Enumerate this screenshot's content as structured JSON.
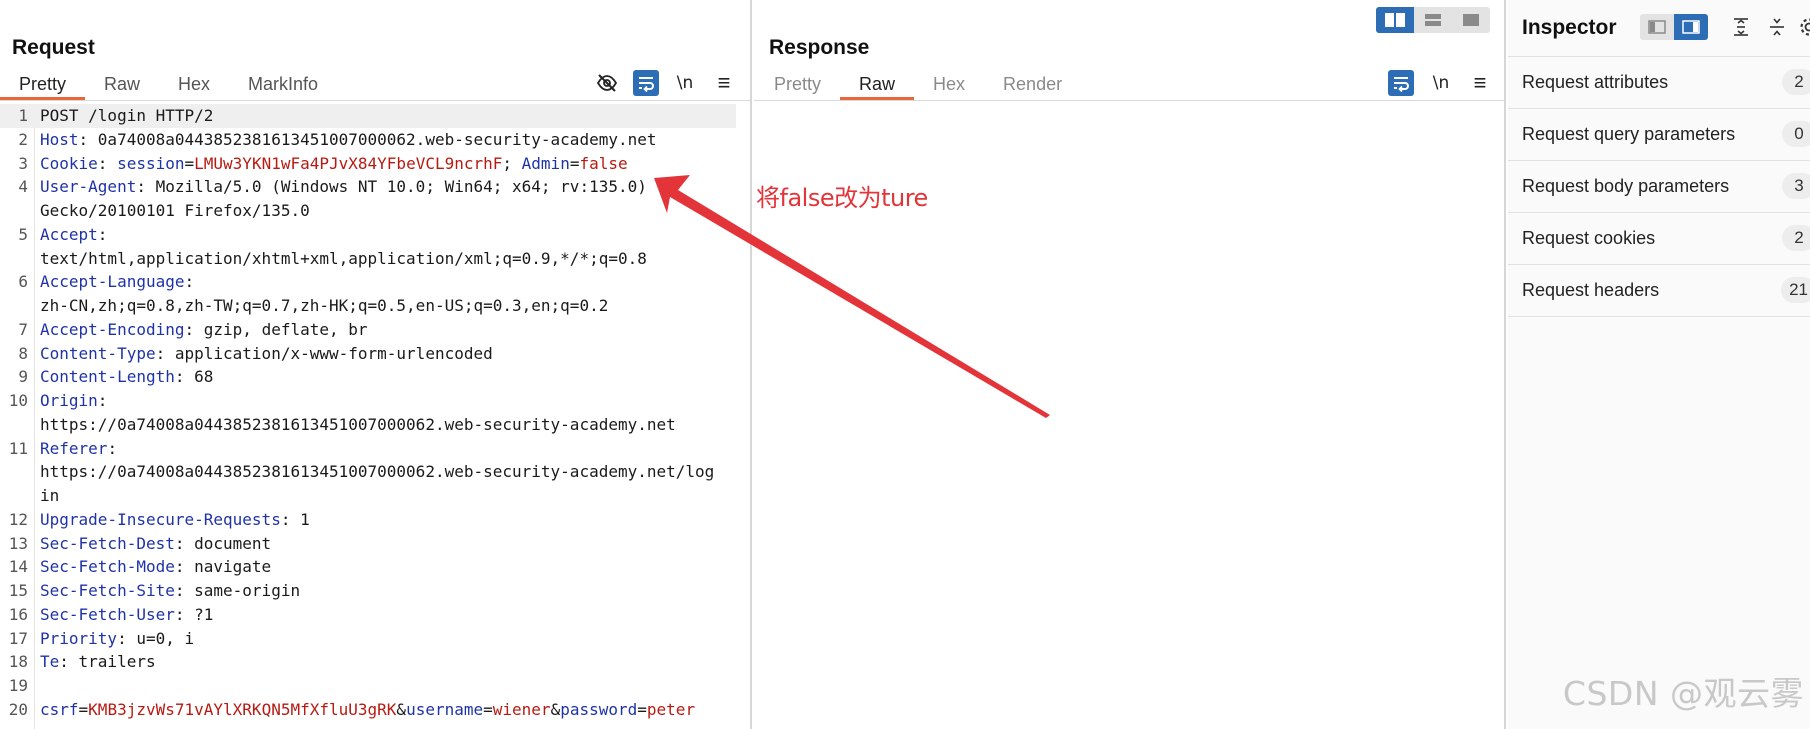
{
  "layout_toggle": {
    "options": [
      "side-by-side",
      "stacked-rows",
      "single-pane"
    ],
    "selected": "side-by-side"
  },
  "request": {
    "title": "Request",
    "tabs": [
      "Pretty",
      "Raw",
      "Hex",
      "MarkInfo"
    ],
    "active_tab": "Pretty",
    "toolbar_icons": [
      "hide-icon",
      "wrap-icon",
      "newline-icon",
      "menu-icon"
    ],
    "newline_label": "\\n",
    "menu_label": "≡",
    "lines": [
      {
        "n": "1",
        "parts": [
          {
            "t": "POST /login HTTP/2",
            "c": "p"
          }
        ]
      },
      {
        "n": "2",
        "parts": [
          {
            "t": "Host",
            "c": "k"
          },
          {
            "t": ": 0a74008a0443852381613451007000062.web-security-academy.net",
            "c": "p"
          }
        ]
      },
      {
        "n": "3",
        "parts": [
          {
            "t": "Cookie",
            "c": "k"
          },
          {
            "t": ": ",
            "c": "p"
          },
          {
            "t": "session",
            "c": "k"
          },
          {
            "t": "=",
            "c": "p"
          },
          {
            "t": "LMUw3YKN1wFa4PJvX84YFbeVCL9ncrhF",
            "c": "v"
          },
          {
            "t": "; ",
            "c": "p"
          },
          {
            "t": "Admin",
            "c": "k"
          },
          {
            "t": "=",
            "c": "p"
          },
          {
            "t": "false",
            "c": "v"
          }
        ]
      },
      {
        "n": "4",
        "parts": [
          {
            "t": "User-Agent",
            "c": "k"
          },
          {
            "t": ": Mozilla/5.0 (Windows NT 10.0; Win64; x64; rv:135.0)",
            "c": "p"
          }
        ]
      },
      {
        "n": "",
        "parts": [
          {
            "t": "Gecko/20100101 Firefox/135.0",
            "c": "p"
          }
        ]
      },
      {
        "n": "5",
        "parts": [
          {
            "t": "Accept",
            "c": "k"
          },
          {
            "t": ":",
            "c": "p"
          }
        ]
      },
      {
        "n": "",
        "parts": [
          {
            "t": "text/html,application/xhtml+xml,application/xml;q=0.9,*/*;q=0.8",
            "c": "p"
          }
        ]
      },
      {
        "n": "6",
        "parts": [
          {
            "t": "Accept-Language",
            "c": "k"
          },
          {
            "t": ":",
            "c": "p"
          }
        ]
      },
      {
        "n": "",
        "parts": [
          {
            "t": "zh-CN,zh;q=0.8,zh-TW;q=0.7,zh-HK;q=0.5,en-US;q=0.3,en;q=0.2",
            "c": "p"
          }
        ]
      },
      {
        "n": "7",
        "parts": [
          {
            "t": "Accept-Encoding",
            "c": "k"
          },
          {
            "t": ": gzip, deflate, br",
            "c": "p"
          }
        ]
      },
      {
        "n": "8",
        "parts": [
          {
            "t": "Content-Type",
            "c": "k"
          },
          {
            "t": ": application/x-www-form-urlencoded",
            "c": "p"
          }
        ]
      },
      {
        "n": "9",
        "parts": [
          {
            "t": "Content-Length",
            "c": "k"
          },
          {
            "t": ": 68",
            "c": "p"
          }
        ]
      },
      {
        "n": "10",
        "parts": [
          {
            "t": "Origin",
            "c": "k"
          },
          {
            "t": ":",
            "c": "p"
          }
        ]
      },
      {
        "n": "",
        "parts": [
          {
            "t": "https://0a74008a0443852381613451007000062.web-security-academy.net",
            "c": "p"
          }
        ]
      },
      {
        "n": "11",
        "parts": [
          {
            "t": "Referer",
            "c": "k"
          },
          {
            "t": ":",
            "c": "p"
          }
        ]
      },
      {
        "n": "",
        "parts": [
          {
            "t": "https://0a74008a0443852381613451007000062.web-security-academy.net/log",
            "c": "p"
          }
        ]
      },
      {
        "n": "",
        "parts": [
          {
            "t": "in",
            "c": "p"
          }
        ]
      },
      {
        "n": "12",
        "parts": [
          {
            "t": "Upgrade-Insecure-Requests",
            "c": "k"
          },
          {
            "t": ": 1",
            "c": "p"
          }
        ]
      },
      {
        "n": "13",
        "parts": [
          {
            "t": "Sec-Fetch-Dest",
            "c": "k"
          },
          {
            "t": ": document",
            "c": "p"
          }
        ]
      },
      {
        "n": "14",
        "parts": [
          {
            "t": "Sec-Fetch-Mode",
            "c": "k"
          },
          {
            "t": ": navigate",
            "c": "p"
          }
        ]
      },
      {
        "n": "15",
        "parts": [
          {
            "t": "Sec-Fetch-Site",
            "c": "k"
          },
          {
            "t": ": same-origin",
            "c": "p"
          }
        ]
      },
      {
        "n": "16",
        "parts": [
          {
            "t": "Sec-Fetch-User",
            "c": "k"
          },
          {
            "t": ": ?1",
            "c": "p"
          }
        ]
      },
      {
        "n": "17",
        "parts": [
          {
            "t": "Priority",
            "c": "k"
          },
          {
            "t": ": u=0, i",
            "c": "p"
          }
        ]
      },
      {
        "n": "18",
        "parts": [
          {
            "t": "Te",
            "c": "k"
          },
          {
            "t": ": trailers",
            "c": "p"
          }
        ]
      },
      {
        "n": "19",
        "parts": [
          {
            "t": " ",
            "c": "p"
          }
        ]
      },
      {
        "n": "20",
        "parts": [
          {
            "t": "csrf",
            "c": "k"
          },
          {
            "t": "=",
            "c": "p"
          },
          {
            "t": "KMB3jzvWs71vAYlXRKQN5MfXfluU3gRK",
            "c": "v"
          },
          {
            "t": "&",
            "c": "p"
          },
          {
            "t": "username",
            "c": "k"
          },
          {
            "t": "=",
            "c": "p"
          },
          {
            "t": "wiener",
            "c": "v"
          },
          {
            "t": "&",
            "c": "p"
          },
          {
            "t": "password",
            "c": "k"
          },
          {
            "t": "=",
            "c": "p"
          },
          {
            "t": "peter",
            "c": "v"
          }
        ]
      }
    ]
  },
  "response": {
    "title": "Response",
    "tabs": [
      "Pretty",
      "Raw",
      "Hex",
      "Render"
    ],
    "active_tab": "Raw",
    "newline_label": "\\n",
    "menu_label": "≡"
  },
  "inspector": {
    "title": "Inspector",
    "sections": [
      {
        "label": "Request attributes",
        "count": "2"
      },
      {
        "label": "Request query parameters",
        "count": "0"
      },
      {
        "label": "Request body parameters",
        "count": "3"
      },
      {
        "label": "Request cookies",
        "count": "2"
      },
      {
        "label": "Request headers",
        "count": "21"
      }
    ]
  },
  "annotation": {
    "text": "将false改为ture",
    "color": "#e3343a"
  },
  "watermark": "CSDN @观云雾",
  "colors": {
    "accent": "#2d6db5",
    "tab_underline": "#e8663d",
    "header_key": "#1f33a8",
    "value": "#b81a12"
  }
}
